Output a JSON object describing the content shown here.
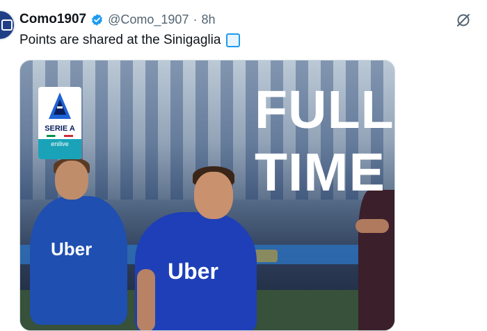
{
  "tweet": {
    "author_name": "Como1907",
    "handle": "@Como_1907",
    "separator": "·",
    "time": "8h",
    "text": "Points are shared at the Sinigaglia"
  },
  "media": {
    "headline_line1": "FULL",
    "headline_line2": "TIME",
    "league_logo_text": "SERIE A",
    "league_sponsor": "enilive",
    "shirt_sponsor": "Uber"
  },
  "colors": {
    "verified": "#1d9bf0",
    "handle_gray": "#536471",
    "como_blue": "#1e3fb8"
  },
  "icons": {
    "verified": "verified-badge-icon",
    "grok": "grok-icon"
  }
}
